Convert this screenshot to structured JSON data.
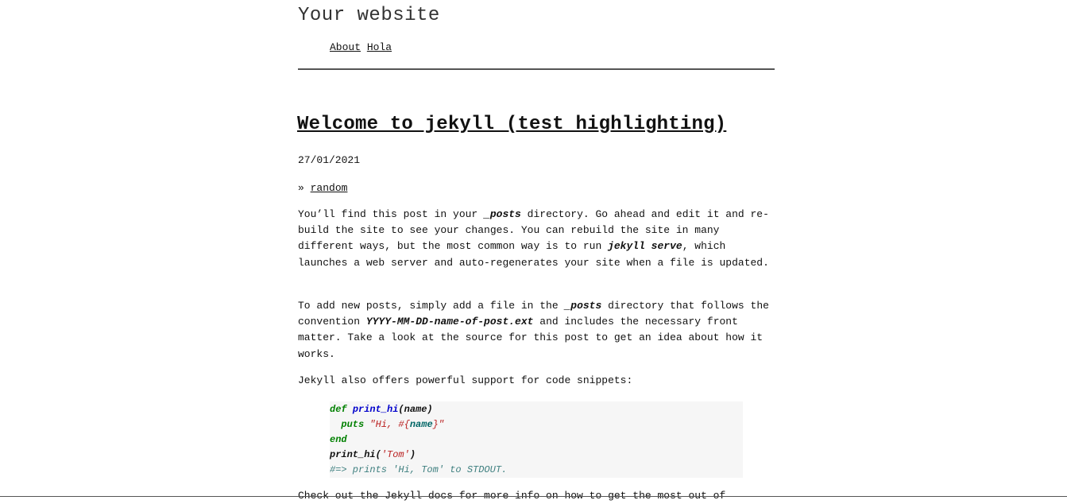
{
  "site": {
    "title": "Your website"
  },
  "nav": {
    "items": [
      "About",
      "Hola"
    ]
  },
  "post": {
    "title": "Welcome to jekyll (test highlighting)",
    "date": "27/01/2021",
    "category_prefix": "»",
    "category": "random",
    "p1": {
      "a": "You’ll find this post in your ",
      "b": "_posts",
      "c": " directory. Go ahead and edit it and re-build the site to see your changes. You can rebuild the site in many different ways, but the most common way is to run ",
      "d": "jekyll serve",
      "e": ", which launches a web server and auto-regenerates your site when a file is updated."
    },
    "p2": {
      "a": "To add new posts, simply add a file in the ",
      "b": "_posts",
      "c": " directory that follows the convention ",
      "d": "YYYY-MM-DD-name-of-post.ext",
      "e": " and includes the necessary front matter. Take a look at the source for this post to get an idea about how it works."
    },
    "p3": "Jekyll also offers powerful support for code snippets:",
    "code": {
      "l1_def": "def",
      "l1_fn": "print_hi",
      "l1_args": "(name)",
      "l2_puts": "puts",
      "l2_str_a": "\"Hi, #{",
      "l2_var": "name",
      "l2_str_b": "}\"",
      "l3_end": "end",
      "l4_call": "print_hi(",
      "l4_str": "'Tom'",
      "l4_close": ")",
      "l5_comment": "#=> prints 'Hi, Tom' to STDOUT."
    },
    "p4": "Check out the Jekyll docs for more info on how to get the most out of"
  }
}
